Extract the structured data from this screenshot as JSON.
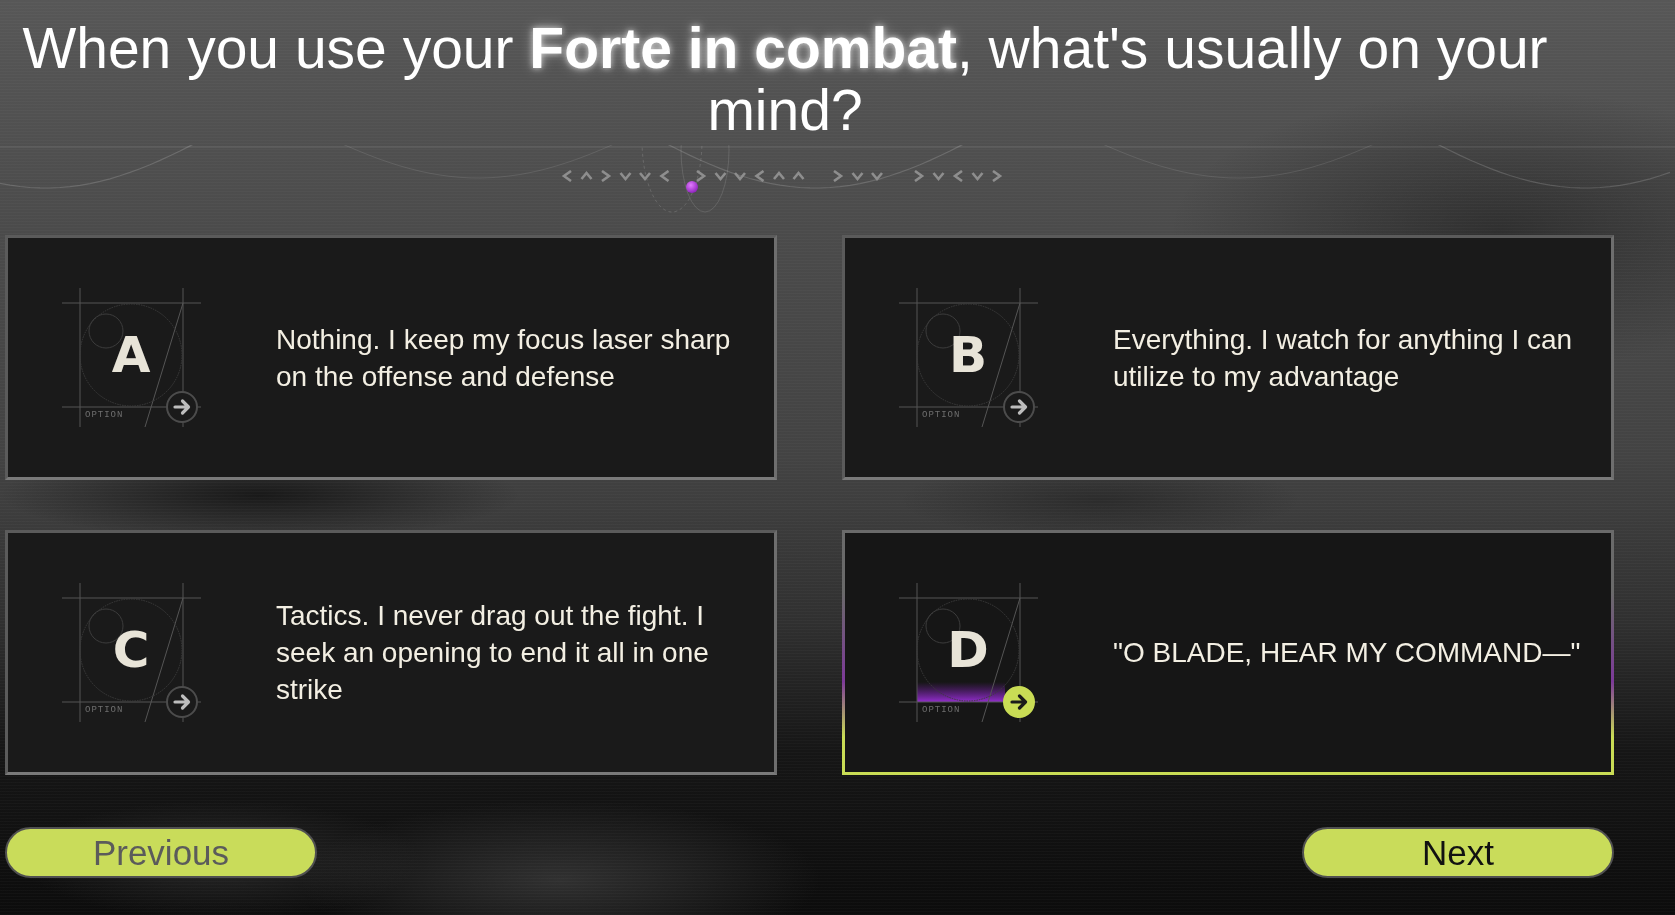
{
  "question": "When you use your **Forte in combat**, what's usually on your mind?",
  "options": [
    {
      "letter": "A",
      "tag": "OPTION",
      "text": "Nothing. I keep my focus laser sharp on the offense and defense",
      "selected": false
    },
    {
      "letter": "B",
      "tag": "OPTION",
      "text": "Everything. I watch for anything I can utilize to my advantage",
      "selected": false
    },
    {
      "letter": "C",
      "tag": "OPTION",
      "text": "Tactics. I never drag out the fight. I seek an opening to end it all in one strike",
      "selected": false
    },
    {
      "letter": "D",
      "tag": "OPTION",
      "text": "\"O BLADE, HEAR MY COMMAND—\"",
      "selected": true
    }
  ],
  "buttons": [
    {
      "label": "Previous",
      "disabled": true
    },
    {
      "label": "Next",
      "disabled": false
    }
  ]
}
